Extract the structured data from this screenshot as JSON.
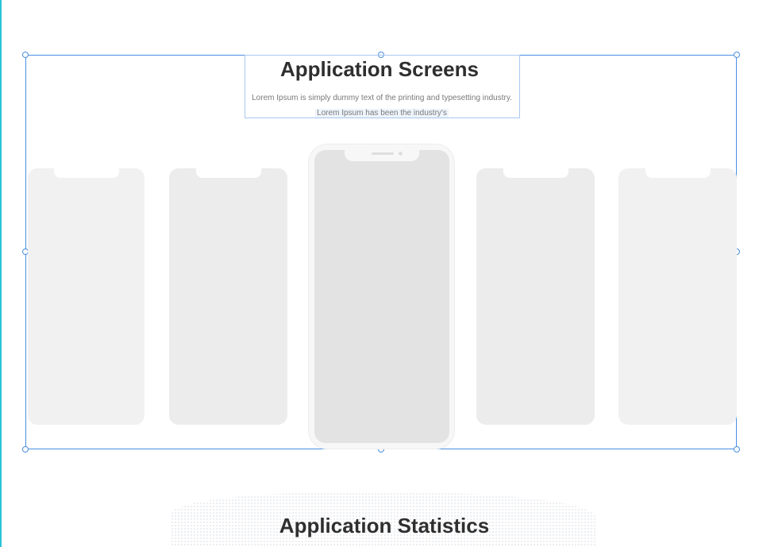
{
  "section_screens": {
    "title": "Application Screens",
    "description_line1": "Lorem Ipsum is simply dummy text of the printing and typesetting industry.",
    "description_line2": "Lorem Ipsum has been the industry's"
  },
  "section_statistics": {
    "title": "Application Statistics"
  },
  "carousel": {
    "item_count": 5,
    "active_index": 2
  },
  "colors": {
    "selection": "#4a8fe0",
    "guide": "#29c4d8",
    "heading": "#2f2f2f",
    "phone_placeholder": "#f1f1f1",
    "active_screen": "#e3e3e3"
  }
}
